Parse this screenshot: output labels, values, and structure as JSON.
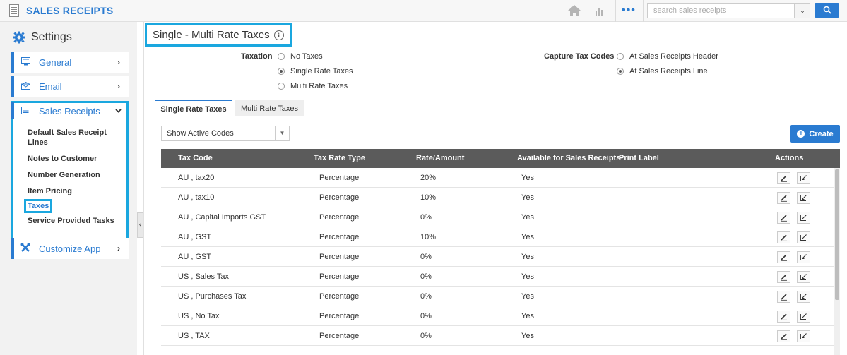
{
  "header": {
    "app_title": "SALES RECEIPTS",
    "search_placeholder": "search sales receipts",
    "icons": [
      "sales-receipt-icon",
      "home-icon",
      "bar-chart-icon",
      "more-icon",
      "chevron-down-icon",
      "search-icon"
    ],
    "more_glyph": "•••",
    "dropdown_glyph": "⌄",
    "search_glyph": "🔍"
  },
  "sidebar": {
    "title": "Settings",
    "items": [
      {
        "label": "General",
        "icon": "monitor-icon"
      },
      {
        "label": "Email",
        "icon": "envelope-icon"
      },
      {
        "label": "Sales Receipts",
        "icon": "receipt-icon"
      },
      {
        "label": "Customize App",
        "icon": "tools-icon"
      }
    ],
    "sub_items": [
      "Default Sales Receipt Lines",
      "Notes to Customer",
      "Number Generation",
      "Item Pricing",
      "Taxes",
      "Service Provided Tasks"
    ],
    "collapse_glyph": "‹"
  },
  "main": {
    "title": "Single - Multi Rate Taxes",
    "info_glyph": "i",
    "taxation": {
      "label": "Taxation",
      "options": [
        "No Taxes",
        "Single Rate Taxes",
        "Multi Rate Taxes"
      ],
      "selected": "Single Rate Taxes"
    },
    "capture": {
      "label": "Capture Tax Codes",
      "options": [
        "At Sales Receipts Header",
        "At Sales Receipts Line"
      ],
      "selected": "At Sales Receipts Line"
    },
    "tabs": [
      {
        "label": "Single Rate Taxes",
        "active": true
      },
      {
        "label": "Multi Rate Taxes",
        "active": false
      }
    ],
    "filter": {
      "selected": "Show Active Codes"
    },
    "create_label": "Create",
    "table": {
      "columns": [
        "Tax Code",
        "Tax Rate Type",
        "Rate/Amount",
        "Available for Sales Receipts",
        "Print Label",
        "Actions"
      ],
      "rows": [
        {
          "code": "AU , tax20",
          "type": "Percentage",
          "rate": "20%",
          "available": "Yes",
          "label": ""
        },
        {
          "code": "AU , tax10",
          "type": "Percentage",
          "rate": "10%",
          "available": "Yes",
          "label": ""
        },
        {
          "code": "AU , Capital Imports GST",
          "type": "Percentage",
          "rate": "0%",
          "available": "Yes",
          "label": ""
        },
        {
          "code": "AU , GST",
          "type": "Percentage",
          "rate": "10%",
          "available": "Yes",
          "label": ""
        },
        {
          "code": "AU , GST",
          "type": "Percentage",
          "rate": "0%",
          "available": "Yes",
          "label": ""
        },
        {
          "code": "US , Sales Tax",
          "type": "Percentage",
          "rate": "0%",
          "available": "Yes",
          "label": ""
        },
        {
          "code": "US , Purchases Tax",
          "type": "Percentage",
          "rate": "0%",
          "available": "Yes",
          "label": ""
        },
        {
          "code": "US , No Tax",
          "type": "Percentage",
          "rate": "0%",
          "available": "Yes",
          "label": ""
        },
        {
          "code": "US , TAX",
          "type": "Percentage",
          "rate": "0%",
          "available": "Yes",
          "label": ""
        }
      ],
      "row_actions": [
        "edit-icon",
        "deactivate-icon"
      ]
    }
  },
  "colors": {
    "accent": "#2a7bd1",
    "highlight": "#1aa7df",
    "table_header": "#5b5b5b"
  }
}
